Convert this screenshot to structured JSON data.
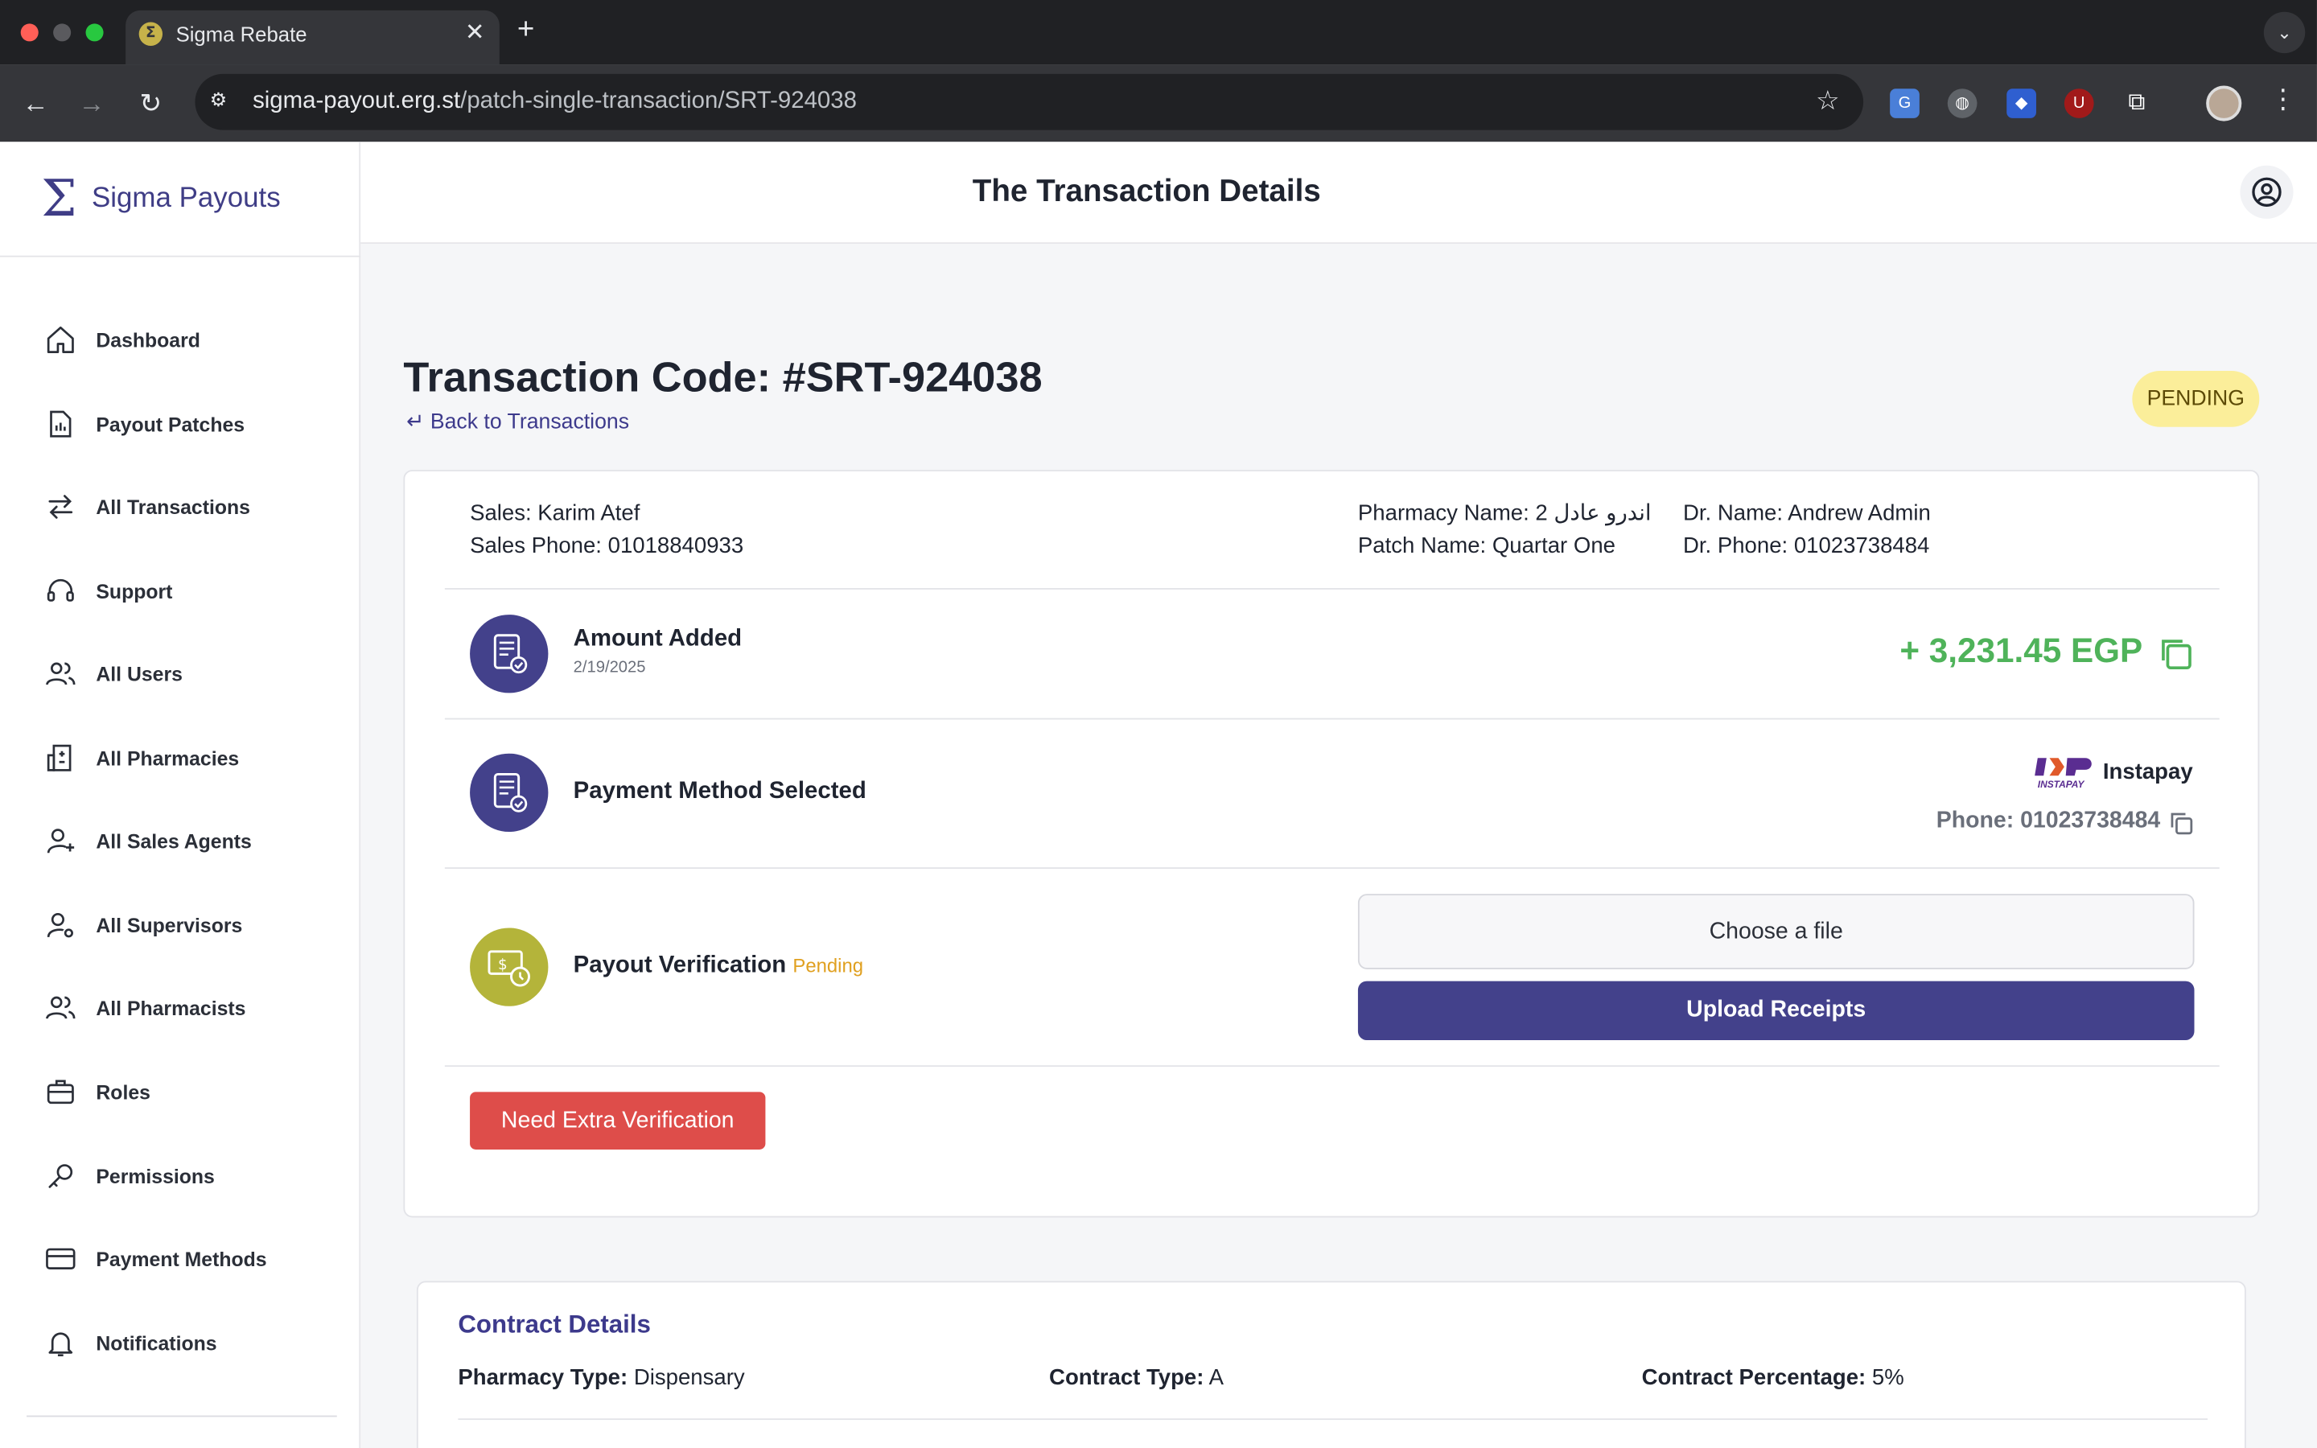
{
  "browser": {
    "tab_title": "Sigma Rebate",
    "url_host": "sigma-payout.erg.st",
    "url_path": "/patch-single-transaction/SRT-924038"
  },
  "sidebar": {
    "brand": "Sigma Payouts",
    "items": [
      {
        "label": "Dashboard",
        "icon": "home-icon"
      },
      {
        "label": "Payout Patches",
        "icon": "chart-document-icon"
      },
      {
        "label": "All Transactions",
        "icon": "swap-arrows-icon"
      },
      {
        "label": "Support",
        "icon": "headset-icon"
      },
      {
        "label": "All Users",
        "icon": "users-icon"
      },
      {
        "label": "All Pharmacies",
        "icon": "building-icon"
      },
      {
        "label": "All Sales Agents",
        "icon": "user-plus-icon"
      },
      {
        "label": "All Supervisors",
        "icon": "user-gear-icon"
      },
      {
        "label": "All Pharmacists",
        "icon": "users-icon"
      },
      {
        "label": "Roles",
        "icon": "briefcase-icon"
      },
      {
        "label": "Permissions",
        "icon": "key-icon"
      },
      {
        "label": "Payment Methods",
        "icon": "credit-card-icon"
      },
      {
        "label": "Notifications",
        "icon": "bell-icon"
      }
    ]
  },
  "header": {
    "title": "The Transaction Details"
  },
  "transaction": {
    "code_title": "Transaction Code: #SRT-924038",
    "back_label": "Back to Transactions",
    "status": "PENDING",
    "sales": "Sales: Karim Atef",
    "sales_phone": "Sales Phone: 01018840933",
    "pharmacy_name": "Pharmacy Name: اندرو عادل 2",
    "patch_name": "Patch Name: Quartar One",
    "dr_name": "Dr. Name: Andrew Admin",
    "dr_phone": "Dr. Phone: 01023738484"
  },
  "steps": {
    "amount_title": "Amount Added",
    "amount_date": "2/19/2025",
    "amount_value": "+ 3,231.45 EGP",
    "method_title": "Payment Method Selected",
    "method_name": "Instapay",
    "method_logo_text": "INSTAPAY",
    "method_phone": "Phone: 01023738484",
    "verify_title": "Payout Verification",
    "verify_status": "Pending",
    "file_label": "Choose a file",
    "upload_label": "Upload Receipts",
    "extra_label": "Need Extra Verification"
  },
  "contract": {
    "title": "Contract Details",
    "pharmacy_type_label": "Pharmacy Type:",
    "pharmacy_type": "Dispensary",
    "contract_type_label": "Contract Type:",
    "contract_type": "A",
    "percentage_label": "Contract Percentage:",
    "percentage": "5%"
  },
  "colors": {
    "primary": "#43418b",
    "success": "#4fb35a",
    "danger": "#de4d4a",
    "pending_bg": "#fbee9a",
    "verify_icon": "#b4b43a"
  }
}
